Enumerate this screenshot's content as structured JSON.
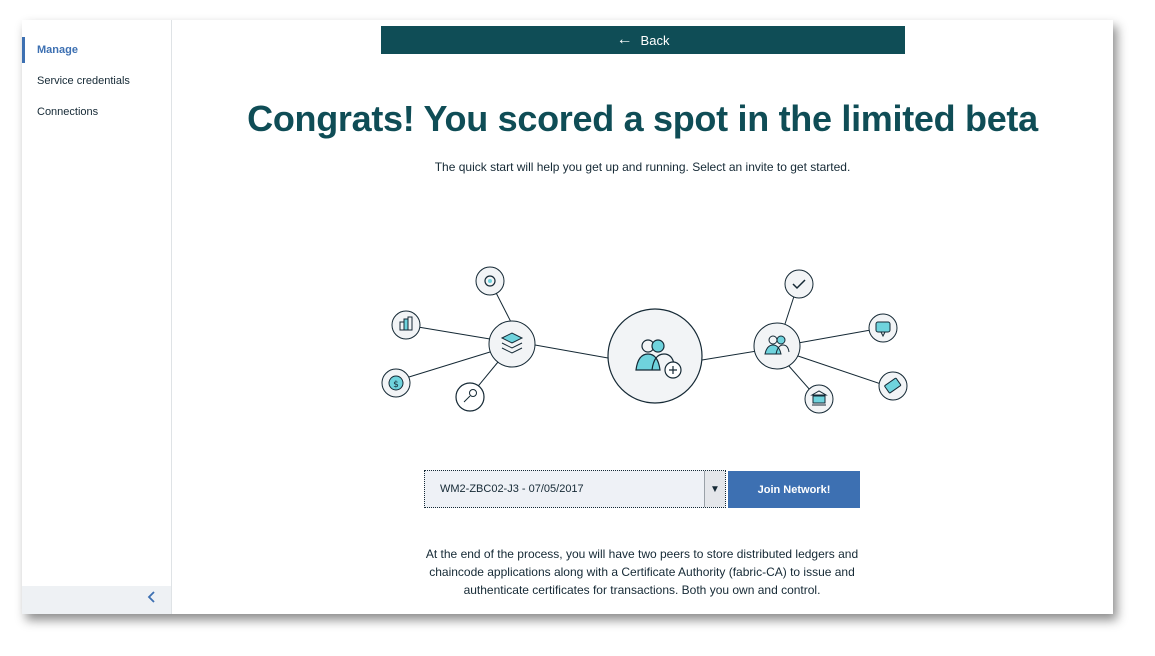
{
  "sidebar": {
    "items": [
      {
        "label": "Manage",
        "active": true
      },
      {
        "label": "Service credentials",
        "active": false
      },
      {
        "label": "Connections",
        "active": false
      }
    ],
    "collapse_icon": "chevron-left-icon"
  },
  "header": {
    "back_label": "Back",
    "back_icon": "arrow-left-icon"
  },
  "main": {
    "headline": "Congrats! You scored a spot in the limited beta",
    "subline": "The quick start will help you get up and running. Select an invite to get started.",
    "invite_select": {
      "value": "WM2-ZBC02-J3 - 07/05/2017"
    },
    "join_label": "Join Network!",
    "footer_text": "At the end of the process, you will have two peers to store distributed ledgers and chaincode applications along with a Certificate Authority (fabric-CA) to issue and authenticate certificates for transactions. Both you own and control."
  },
  "illustration": {
    "icons": [
      "gear-icon",
      "building-icon",
      "layers-icon",
      "dollar-icon",
      "key-icon",
      "network-people-icon",
      "people-icon",
      "checkmark-icon",
      "chat-icon",
      "bank-icon",
      "ticket-icon"
    ]
  },
  "colors": {
    "accent_dark": "#0f4d56",
    "accent_light": "#6fd3dd",
    "primary_blue": "#3d70b2"
  }
}
